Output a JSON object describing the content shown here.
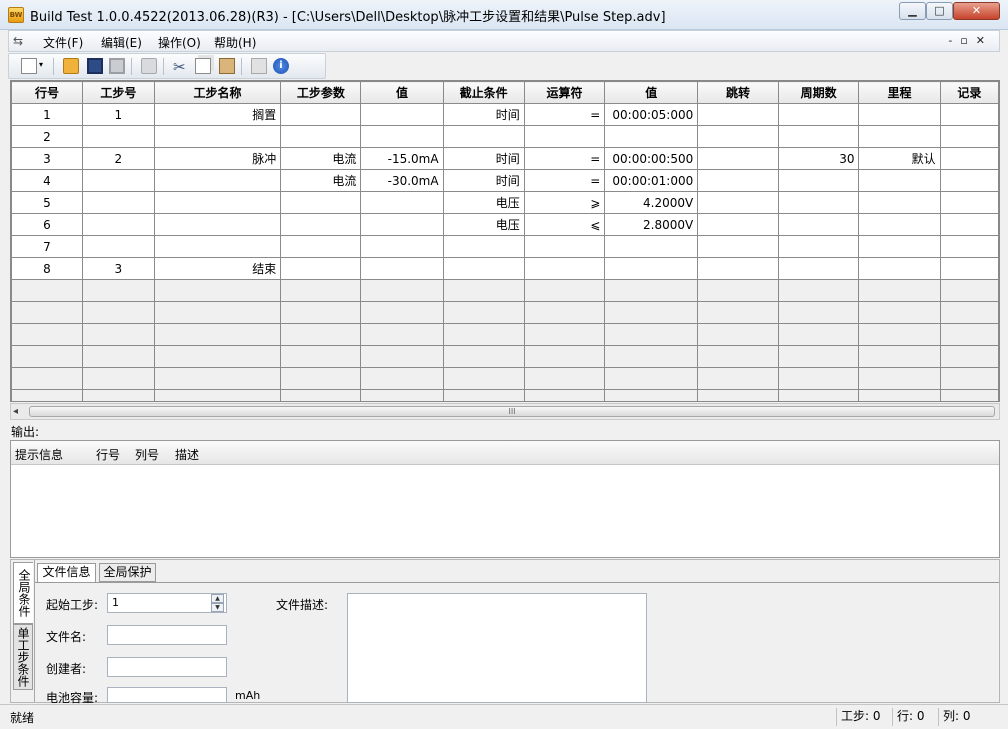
{
  "window": {
    "title": "Build Test  1.0.0.4522(2013.06.28)(R3) - [C:\\Users\\Dell\\Desktop\\脉冲工步设置和结果\\Pulse Step.adv]",
    "icon_text": "BW"
  },
  "menu": {
    "items": [
      "文件(F)",
      "编辑(E)",
      "操作(O)",
      "帮助(H)"
    ]
  },
  "toolbar": {
    "icons": [
      "new-icon",
      "dropdown-arrow-icon",
      "open-folder-icon",
      "save-icon",
      "save-all-icon",
      "print-icon",
      "cut-icon",
      "copy-icon",
      "paste-icon",
      "check-icon",
      "help-icon"
    ]
  },
  "grid": {
    "columns": [
      "行号",
      "工步号",
      "工步名称",
      "工步参数",
      "值",
      "截止条件",
      "运算符",
      "值",
      "跳转",
      "周期数",
      "里程",
      "记录"
    ],
    "rows": [
      [
        "1",
        "1",
        "搁置",
        "",
        "",
        "时间",
        "=",
        "00:00:05:000",
        "",
        "",
        "",
        ""
      ],
      [
        "2",
        "",
        "",
        "",
        "",
        "",
        "",
        "",
        "",
        "",
        "",
        ""
      ],
      [
        "3",
        "2",
        "脉冲",
        "电流",
        "-15.0mA",
        "时间",
        "=",
        "00:00:00:500",
        "",
        "30",
        "默认",
        ""
      ],
      [
        "4",
        "",
        "",
        "电流",
        "-30.0mA",
        "时间",
        "=",
        "00:00:01:000",
        "",
        "",
        "",
        ""
      ],
      [
        "5",
        "",
        "",
        "",
        "",
        "电压",
        "⩾",
        "4.2000V",
        "",
        "",
        "",
        ""
      ],
      [
        "6",
        "",
        "",
        "",
        "",
        "电压",
        "⩽",
        "2.8000V",
        "",
        "",
        "",
        ""
      ],
      [
        "7",
        "",
        "",
        "",
        "",
        "",
        "",
        "",
        "",
        "",
        "",
        ""
      ],
      [
        "8",
        "3",
        "结束",
        "",
        "",
        "",
        "",
        "",
        "",
        "",
        "",
        ""
      ]
    ],
    "empty_row_count": 6
  },
  "scrollbar": {
    "thumb_grip": "III",
    "left_arrow": "◂"
  },
  "output": {
    "label": "输出:",
    "columns": [
      "提示信息",
      "行号",
      "列号",
      "描述"
    ]
  },
  "bottom": {
    "vtabs": [
      "全局条件",
      "单工步条件"
    ],
    "htabs": [
      "文件信息",
      "全局保护"
    ],
    "fields": {
      "start_step_label": "起始工步:",
      "start_step_value": "1",
      "file_name_label": "文件名:",
      "creator_label": "创建者:",
      "capacity_label": "电池容量:",
      "capacity_unit": "mAh",
      "desc_label": "文件描述:"
    }
  },
  "status": {
    "text": "就绪",
    "step": "工步: 0",
    "row": "行: 0",
    "col": "列: 0"
  }
}
